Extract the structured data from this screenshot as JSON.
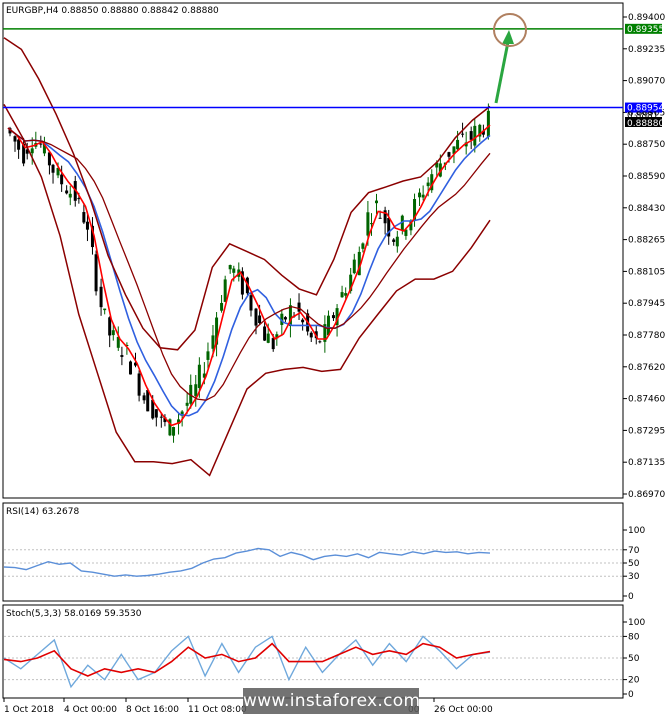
{
  "main_title": "EURGBP,H4  0.88850 0.88880 0.88842 0.88880",
  "price_axis": [
    "0.89400",
    "0.89235",
    "0.89070",
    "0.88905",
    "0.88750",
    "0.88590",
    "0.88430",
    "0.88265",
    "0.88105",
    "0.87945",
    "0.87780",
    "0.87620",
    "0.87460",
    "0.87295",
    "0.87135",
    "0.86970"
  ],
  "price_range": [
    0.8697,
    0.894
  ],
  "markers": {
    "green_level": "0.89355",
    "blue_level": "0.88954",
    "current_price": "0.88880",
    "partial_label": "0.8881"
  },
  "rsi": {
    "title": "RSI(14) 63.2678",
    "axis": [
      "100",
      "70",
      "50",
      "30",
      "0"
    ],
    "levels": [
      70,
      50,
      30
    ]
  },
  "stoch": {
    "title": "Stoch(5,3,3) 58.0169 59.3530",
    "axis": [
      "100",
      "80",
      "50",
      "20",
      "0"
    ],
    "levels": [
      80,
      50,
      20
    ]
  },
  "time_axis": [
    "1 Oct 2018",
    "4 Oct 00:00",
    "8 Oct 16:00",
    "11 Oct 08:00",
    "26 Oct 00:00"
  ],
  "time_axis_partial": "00",
  "watermark": "www.instaforex.com",
  "colors": {
    "bollinger": "#8b0000",
    "ma_fast": "#ff0000",
    "ma_slow": "#3060e0",
    "green_line": "#008000",
    "blue_line": "#0000ff",
    "rsi_line": "#5b8fd8",
    "stoch_main": "#6fa8dc",
    "stoch_signal": "#e00000",
    "arrow": "#2aa640",
    "circle": "#b08060",
    "bull_candle": "#006400",
    "bear_candle": "#000000"
  },
  "chart_data": [
    {
      "type": "candlestick",
      "title": "EURGBP,H4",
      "ylim": [
        0.8697,
        0.894
      ],
      "x_labels": [
        "1 Oct 2018",
        "4 Oct 00:00",
        "8 Oct 16:00",
        "11 Oct 08:00",
        "26 Oct 00:00"
      ],
      "series": [
        {
          "name": "close_approx",
          "values": [
            0.8885,
            0.8878,
            0.8872,
            0.888,
            0.8876,
            0.8868,
            0.886,
            0.8855,
            0.885,
            0.884,
            0.882,
            0.8795,
            0.878,
            0.8775,
            0.877,
            0.876,
            0.8748,
            0.8742,
            0.8735,
            0.8732,
            0.8738,
            0.8745,
            0.8752,
            0.8765,
            0.878,
            0.88,
            0.8815,
            0.8808,
            0.88,
            0.879,
            0.878,
            0.8775,
            0.8785,
            0.8792,
            0.879,
            0.878,
            0.8775,
            0.878,
            0.879,
            0.88,
            0.881,
            0.8822,
            0.884,
            0.8845,
            0.8838,
            0.883,
            0.8835,
            0.884,
            0.885,
            0.8858,
            0.8865,
            0.887,
            0.8875,
            0.8878,
            0.888,
            0.8885,
            0.8888
          ]
        },
        {
          "name": "bollinger_upper",
          "values": [
            0.8931,
            0.8925,
            0.891,
            0.8892,
            0.8872,
            0.8848,
            0.882,
            0.88,
            0.8783,
            0.8773,
            0.8772,
            0.8782,
            0.8814,
            0.8826,
            0.8822,
            0.8818,
            0.881,
            0.8803,
            0.88,
            0.8818,
            0.8842,
            0.8852,
            0.8855,
            0.8858,
            0.886,
            0.8868,
            0.888,
            0.8889,
            0.8896
          ]
        },
        {
          "name": "bollinger_lower",
          "values": [
            0.8897,
            0.888,
            0.886,
            0.883,
            0.879,
            0.876,
            0.873,
            0.8715,
            0.8715,
            0.8714,
            0.8716,
            0.8708,
            0.873,
            0.8752,
            0.876,
            0.8762,
            0.8763,
            0.8761,
            0.8762,
            0.8778,
            0.879,
            0.8802,
            0.8808,
            0.8808,
            0.8812,
            0.8824,
            0.8838
          ]
        }
      ]
    },
    {
      "type": "line",
      "title": "RSI(14) 63.2678",
      "ylim": [
        0,
        100
      ],
      "series": [
        {
          "name": "RSI(14)",
          "values": [
            44,
            43,
            40,
            46,
            52,
            48,
            50,
            38,
            36,
            33,
            30,
            32,
            30,
            31,
            33,
            36,
            38,
            42,
            50,
            56,
            58,
            65,
            68,
            72,
            70,
            60,
            66,
            62,
            55,
            60,
            62,
            60,
            64,
            58,
            66,
            64,
            62,
            67,
            64,
            68,
            66,
            67,
            64,
            66,
            65
          ]
        }
      ]
    },
    {
      "type": "line",
      "title": "Stoch(5,3,3) 58.0169 59.3530",
      "ylim": [
        0,
        100
      ],
      "series": [
        {
          "name": "main",
          "values": [
            50,
            35,
            55,
            75,
            10,
            40,
            20,
            55,
            20,
            30,
            60,
            80,
            25,
            70,
            30,
            65,
            80,
            20,
            65,
            30,
            55,
            75,
            40,
            70,
            45,
            80,
            60,
            35,
            55,
            58
          ]
        },
        {
          "name": "signal",
          "values": [
            48,
            45,
            50,
            60,
            35,
            25,
            35,
            30,
            35,
            30,
            45,
            65,
            50,
            55,
            45,
            50,
            70,
            45,
            45,
            45,
            55,
            65,
            55,
            60,
            55,
            70,
            65,
            50,
            55,
            59
          ]
        }
      ]
    }
  ]
}
